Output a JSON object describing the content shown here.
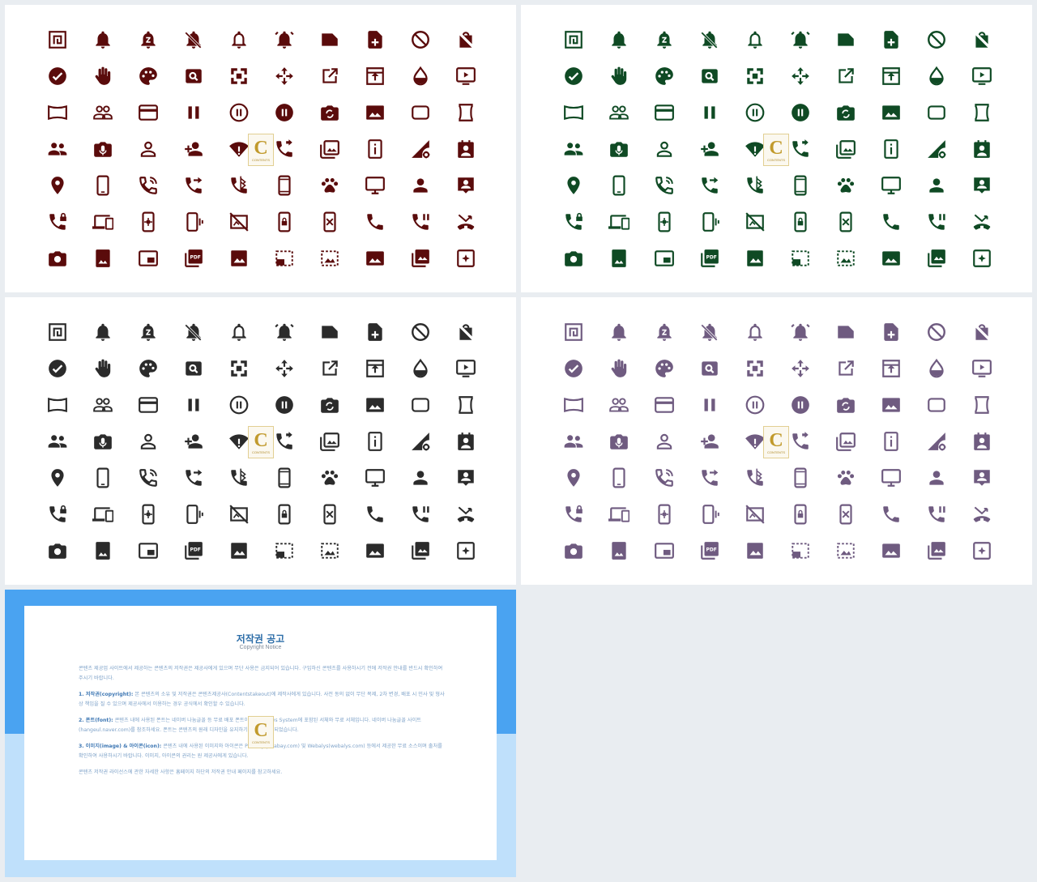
{
  "icon_names": [
    [
      "aspect-ratio-icon",
      "bell-icon",
      "bell-z-icon",
      "bell-off-icon",
      "bell-outline-icon",
      "alarm-ring-icon",
      "note-icon",
      "file-add-icon",
      "block-icon",
      "shopping-bag-off-icon"
    ],
    [
      "check-circle-icon",
      "raised-hand-icon",
      "palette-icon",
      "image-search-icon",
      "drag-pan-icon",
      "move-arrows-icon",
      "external-link-icon",
      "upload-box-icon",
      "drop-outline-icon",
      "ondemand-video-icon"
    ],
    [
      "panorama-icon",
      "people-outline-icon",
      "credit-card-icon",
      "pause-icon",
      "pause-circle-outline-icon",
      "pause-circle-icon",
      "camera-switch-icon",
      "image-icon",
      "rounded-rect-icon",
      "hourglass-frame-icon"
    ],
    [
      "group-icon",
      "mic-photo-icon",
      "person-outline-icon",
      "person-add-icon",
      "wifi-alert-icon",
      "phone-forward-icon",
      "photo-library-icon",
      "badge-info-icon",
      "signal-settings-icon",
      "portrait-icon"
    ],
    [
      "location-pin-icon",
      "smartphone-icon",
      "phone-in-talk-icon",
      "phone-forwarded-icon",
      "phone-bluetooth-icon",
      "mobile-device-icon",
      "pets-icon",
      "desktop-icon",
      "person-icon",
      "contact-card-icon"
    ],
    [
      "phone-locked-icon",
      "devices-icon",
      "phone-settings-icon",
      "phone-vibrate-icon",
      "portable-off-icon",
      "phone-lock-icon",
      "phone-disabled-icon",
      "phone-icon",
      "phone-paused-icon",
      "call-missed-icon"
    ],
    [
      "camera-icon",
      "portrait-image-icon",
      "picture-in-picture-icon",
      "pdf-icon",
      "landscape-icon",
      "select-bottom-icon",
      "select-image-icon",
      "image-filled-icon",
      "photo-library-filled-icon",
      "auto-awesome-icon"
    ]
  ],
  "palettes": {
    "panel_1": "#5a0b0b",
    "panel_2": "#0f4a24",
    "panel_3": "#2b2b2b",
    "panel_4": "#6f5b80"
  },
  "watermark": {
    "letter": "C",
    "tagline": "CONTENTS"
  },
  "copyright": {
    "title": "저작권 공고",
    "subtitle": "Copyright Notice",
    "intro": "콘텐츠 제공업 사이트에서 제공하는 콘텐츠의 저작권은 제공사에게 있으며 무단 사용은 금지되어 있습니다. 구입하신 콘텐츠를 사용하시기 전에 저작권 안내를 반드시 확인하여 주시기 바랍니다.",
    "s1_title": "1. 저작권(copyright):",
    "s1_body": "본 콘텐츠의 소유 및 저작권은 콘텐츠제공사(Contentstakeout)에 제작사에게 있습니다. 사전 동의 없이 무단 복제, 2차 변경, 배포 시 민사 및 형사상 책임을 질 수 있으며 제공사에서 이용하는 경우 공식에서 확인할 수 있습니다.",
    "s2_title": "2. 폰트(font):",
    "s2_body": "콘텐츠 내에 사용된 폰트는 네이버 나눔글꼴 등 무료 배포 폰트이며 Windows System에 포함된 서체와 무료 서체입니다. 네이버 나눔글꼴 사이트(hangeul.naver.com)를 참조하세요. 폰트는 콘텐츠의 원래 디자인을 유지하기 위하여 사용되었습니다.",
    "s3_title": "3. 이미지(image) & 아이콘(icon):",
    "s3_body": "콘텐츠 내에 사용된 이미지와 아이콘은 Pixabay(pixabay.com) 및 Webalys(webalys.com) 등에서 제공한 무료 소스이며 출처를 확인하여 사용하시기 바랍니다. 이미지, 아이콘의 권리는 원 제공사에게 있습니다.",
    "outro": "콘텐츠 저작권 라이선스에 관한 자세한 사항은 홈페이지 하단의 저작권 안내 페이지를 참고하세요."
  }
}
